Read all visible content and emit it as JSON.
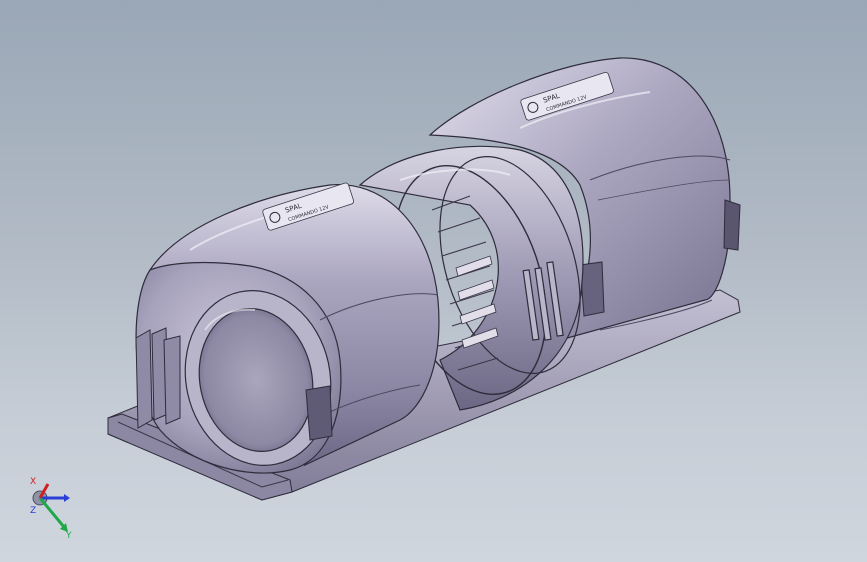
{
  "viewport": {
    "background_top": "#9aa7b6",
    "background_bottom": "#d0d6de"
  },
  "model": {
    "body_color": "#9d98b2",
    "highlight_color": "#d9d6e6",
    "shadow_color": "#5a5670",
    "edge_color": "#2f2c3c",
    "labels": [
      {
        "line1": "SPAL",
        "line2": "COMMANDO 12V"
      },
      {
        "line1": "SPAL",
        "line2": "COMMANDO 12V"
      }
    ]
  },
  "triad": {
    "x_label": "X",
    "y_label": "Y",
    "z_label": "Z",
    "x_color": "#d02020",
    "y_color": "#1fa84a",
    "z_color": "#2a3fd6"
  }
}
